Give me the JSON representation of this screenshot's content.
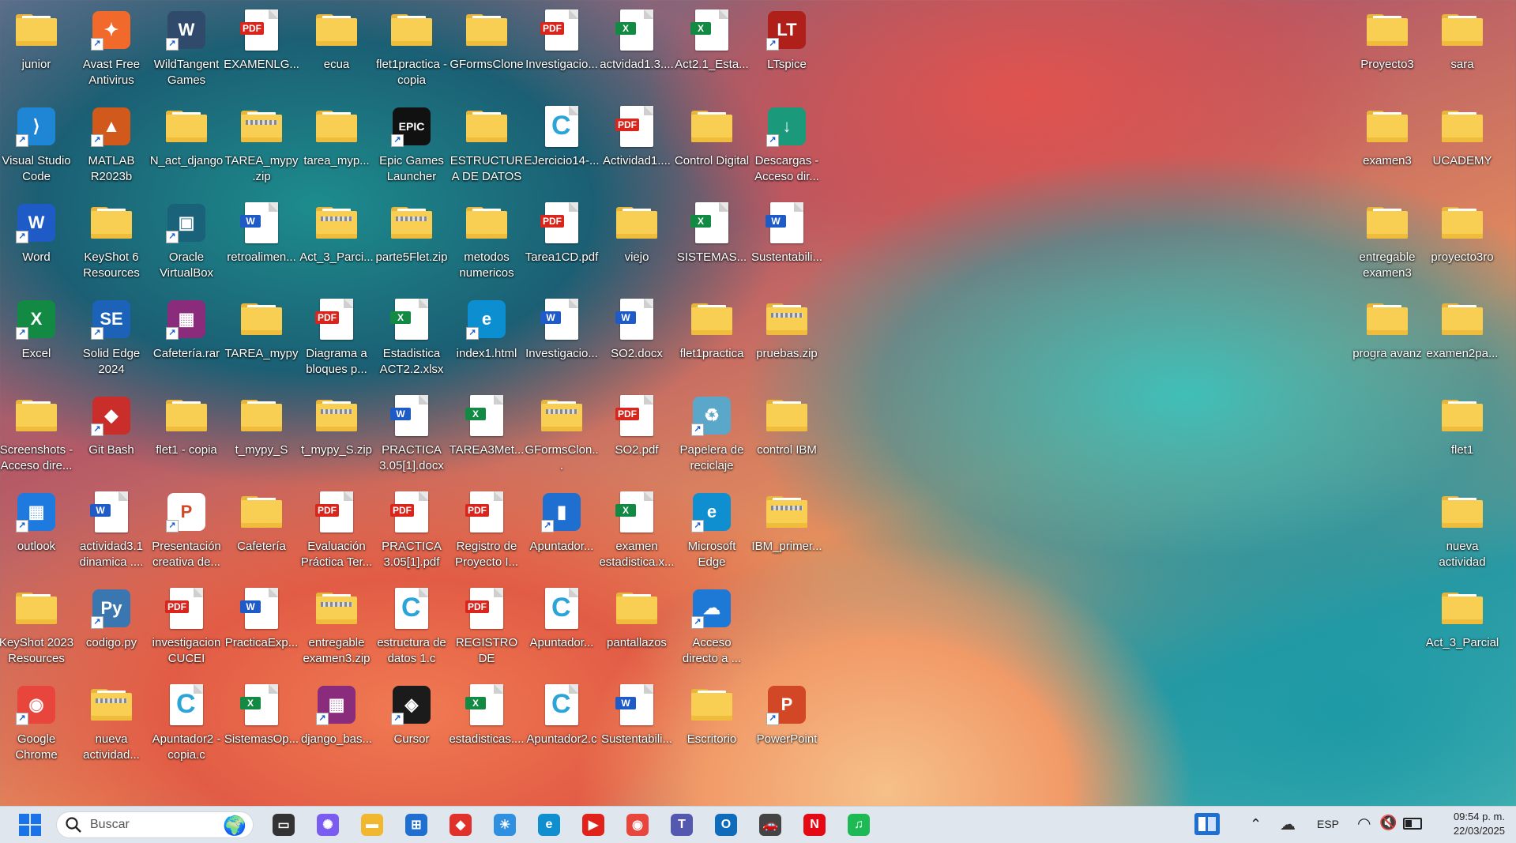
{
  "desktop": {
    "icons": [
      {
        "label": "junior",
        "type": "folder"
      },
      {
        "label": "Avast Free Antivirus",
        "type": "app",
        "color": "#f26a2b",
        "glyph": "✦"
      },
      {
        "label": "WildTangent Games",
        "type": "app",
        "color": "#2f4a6a",
        "glyph": "W"
      },
      {
        "label": "EXAMENLG...",
        "type": "pdf"
      },
      {
        "label": "ecua",
        "type": "folder"
      },
      {
        "label": "flet1practica - copia",
        "type": "folder"
      },
      {
        "label": "GFormsClone",
        "type": "folder"
      },
      {
        "label": "Investigacio...",
        "type": "pdf"
      },
      {
        "label": "actvidad1.3....",
        "type": "excel"
      },
      {
        "label": "Act2.1_Esta...",
        "type": "excel"
      },
      {
        "label": "LTspice",
        "type": "app",
        "color": "#b0201a",
        "glyph": "LT"
      },
      {
        "label": "Proyecto3",
        "type": "folder"
      },
      {
        "label": "sara",
        "type": "folder"
      },
      {
        "label": "Visual Studio Code",
        "type": "app",
        "color": "#1f86d6",
        "glyph": "⟩"
      },
      {
        "label": "MATLAB R2023b",
        "type": "app",
        "color": "#d2591c",
        "glyph": "▲"
      },
      {
        "label": "N_act_django",
        "type": "folder"
      },
      {
        "label": "TAREA_mypy .zip",
        "type": "zip"
      },
      {
        "label": "tarea_myp...",
        "type": "folder"
      },
      {
        "label": "Epic Games Launcher",
        "type": "app",
        "color": "#111111",
        "glyph": "EPIC"
      },
      {
        "label": "ESTRUCTURA DE DATOS",
        "type": "folder"
      },
      {
        "label": "EJercicio14-...",
        "type": "c"
      },
      {
        "label": "Actividad1....",
        "type": "pdf"
      },
      {
        "label": "Control Digital",
        "type": "folder"
      },
      {
        "label": "Descargas - Acceso dir...",
        "type": "app",
        "color": "#1a9a7a",
        "glyph": "↓"
      },
      {
        "label": "examen3",
        "type": "folder"
      },
      {
        "label": "UCADEMY",
        "type": "folder"
      },
      {
        "label": "Word",
        "type": "app",
        "color": "#1f5bc6",
        "glyph": "W"
      },
      {
        "label": "KeyShot 6 Resources",
        "type": "folder"
      },
      {
        "label": "Oracle VirtualBox",
        "type": "app",
        "color": "#19627a",
        "glyph": "▣"
      },
      {
        "label": "retroalimen...",
        "type": "word"
      },
      {
        "label": "Act_3_Parci...",
        "type": "zip"
      },
      {
        "label": "parte5Flet.zip",
        "type": "zip"
      },
      {
        "label": "metodos numericos",
        "type": "folder"
      },
      {
        "label": "Tarea1CD.pdf",
        "type": "pdf"
      },
      {
        "label": "viejo",
        "type": "folder"
      },
      {
        "label": "SISTEMAS...",
        "type": "excel"
      },
      {
        "label": "Sustentabili...",
        "type": "word"
      },
      {
        "label": "entregable examen3",
        "type": "folder"
      },
      {
        "label": "proyecto3ro",
        "type": "folder"
      },
      {
        "label": "Excel",
        "type": "app",
        "color": "#138a44",
        "glyph": "X"
      },
      {
        "label": "Solid Edge 2024",
        "type": "app",
        "color": "#1c62b9",
        "glyph": "SE"
      },
      {
        "label": "Cafetería.rar",
        "type": "app",
        "color": "#8a2b7c",
        "glyph": "▦"
      },
      {
        "label": "TAREA_mypy",
        "type": "folder"
      },
      {
        "label": "Diagrama a bloques p...",
        "type": "pdf"
      },
      {
        "label": "Estadistica ACT2.2.xlsx",
        "type": "excel"
      },
      {
        "label": "index1.html",
        "type": "app",
        "color": "#0c8fd1",
        "glyph": "e"
      },
      {
        "label": "Investigacio...",
        "type": "word"
      },
      {
        "label": "SO2.docx",
        "type": "word"
      },
      {
        "label": "flet1practica",
        "type": "folder"
      },
      {
        "label": "pruebas.zip",
        "type": "zip"
      },
      {
        "label": "progra avanz",
        "type": "folder"
      },
      {
        "label": "examen2pa...",
        "type": "folder"
      },
      {
        "label": "Screenshots - Acceso dire...",
        "type": "folder"
      },
      {
        "label": "Git Bash",
        "type": "app",
        "color": "#c92e2a",
        "glyph": "◆"
      },
      {
        "label": "flet1 - copia",
        "type": "folder"
      },
      {
        "label": "t_mypy_S",
        "type": "folder"
      },
      {
        "label": "t_mypy_S.zip",
        "type": "zip"
      },
      {
        "label": "PRACTICA 3.05[1].docx",
        "type": "word"
      },
      {
        "label": "TAREA3Met...",
        "type": "excel"
      },
      {
        "label": "GFormsClon...",
        "type": "zip"
      },
      {
        "label": "SO2.pdf",
        "type": "pdf"
      },
      {
        "label": "Papelera de reciclaje",
        "type": "app",
        "color": "#5aa7c9",
        "glyph": "♻"
      },
      {
        "label": "control IBM",
        "type": "folder"
      },
      {
        "label": "flet1",
        "type": "folder"
      },
      {
        "label": "outlook",
        "type": "app",
        "color": "#1f7ae0",
        "glyph": "▦"
      },
      {
        "label": "actividad3.1 dinamica ....",
        "type": "word"
      },
      {
        "label": "Presentación creativa de...",
        "type": "app",
        "color": "#ffffff",
        "glyph": "P"
      },
      {
        "label": "Cafetería",
        "type": "folder"
      },
      {
        "label": "Evaluación Práctica Ter...",
        "type": "pdf"
      },
      {
        "label": "PRACTICA 3.05[1].pdf",
        "type": "pdf"
      },
      {
        "label": "Registro de Proyecto I...",
        "type": "pdf"
      },
      {
        "label": "Apuntador...",
        "type": "app",
        "color": "#1f6fd0",
        "glyph": "▮"
      },
      {
        "label": "examen estadistica.x...",
        "type": "excel"
      },
      {
        "label": "Microsoft Edge",
        "type": "app",
        "color": "#0f8fd0",
        "glyph": "e"
      },
      {
        "label": "IBM_primer...",
        "type": "zip"
      },
      {
        "label": "nueva actividad",
        "type": "folder"
      },
      {
        "label": "KeyShot 2023 Resources",
        "type": "folder"
      },
      {
        "label": "codigo.py",
        "type": "app",
        "color": "#3a76b0",
        "glyph": "Py"
      },
      {
        "label": "investigacion CUCEI FGC....",
        "type": "pdf"
      },
      {
        "label": "PracticaExp...",
        "type": "word"
      },
      {
        "label": "entregable examen3.zip",
        "type": "zip"
      },
      {
        "label": "estructura de datos 1.c",
        "type": "c"
      },
      {
        "label": "REGISTRO DE PROYECTO I...",
        "type": "pdf"
      },
      {
        "label": "Apuntador...",
        "type": "c"
      },
      {
        "label": "pantallazos",
        "type": "folder"
      },
      {
        "label": "Acceso directo a ...",
        "type": "app",
        "color": "#1e78d6",
        "glyph": "☁"
      },
      {
        "label": "Act_3_Parcial",
        "type": "folder"
      },
      {
        "label": "Google Chrome",
        "type": "app",
        "color": "#e8453c",
        "glyph": "◉"
      },
      {
        "label": "nueva actividad...",
        "type": "zip"
      },
      {
        "label": "Apuntador2 - copia.c",
        "type": "c"
      },
      {
        "label": "SistemasOp...",
        "type": "excel"
      },
      {
        "label": "django_bas...",
        "type": "app",
        "color": "#8a2b7c",
        "glyph": "▦"
      },
      {
        "label": "Cursor",
        "type": "app",
        "color": "#1b1b1b",
        "glyph": "◈"
      },
      {
        "label": "estadisticas....",
        "type": "excel"
      },
      {
        "label": "Apuntador2.c",
        "type": "c"
      },
      {
        "label": "Sustentabili...",
        "type": "word"
      },
      {
        "label": "Escritorio",
        "type": "folder"
      },
      {
        "label": "PowerPoint",
        "type": "app",
        "color": "#d24726",
        "glyph": "P"
      }
    ]
  },
  "taskbar": {
    "search_placeholder": "Buscar",
    "apps": [
      {
        "name": "task-view",
        "color": "#333",
        "glyph": "▭"
      },
      {
        "name": "copilot",
        "color": "#7a5cf0",
        "glyph": "✺"
      },
      {
        "name": "file-explorer",
        "color": "#f1b72f",
        "glyph": "▬"
      },
      {
        "name": "microsoft-store",
        "color": "#1f6fd0",
        "glyph": "⊞"
      },
      {
        "name": "red-diamond-app",
        "color": "#e0322b",
        "glyph": "◆"
      },
      {
        "name": "weather-app",
        "color": "#2f8fe0",
        "glyph": "☀"
      },
      {
        "name": "edge",
        "color": "#0f8fd0",
        "glyph": "e"
      },
      {
        "name": "youtube",
        "color": "#e0221b",
        "glyph": "▶"
      },
      {
        "name": "chrome",
        "color": "#e8453c",
        "glyph": "◉"
      },
      {
        "name": "teams",
        "color": "#5558af",
        "glyph": "T"
      },
      {
        "name": "outlook",
        "color": "#0f6cbd",
        "glyph": "O"
      },
      {
        "name": "car-app",
        "color": "#444",
        "glyph": "🚗"
      },
      {
        "name": "netflix",
        "color": "#e50914",
        "glyph": "N"
      },
      {
        "name": "spotify",
        "color": "#1db954",
        "glyph": "♫"
      }
    ],
    "language": "ESP",
    "time": "09:54 p. m.",
    "date": "22/03/2025"
  }
}
